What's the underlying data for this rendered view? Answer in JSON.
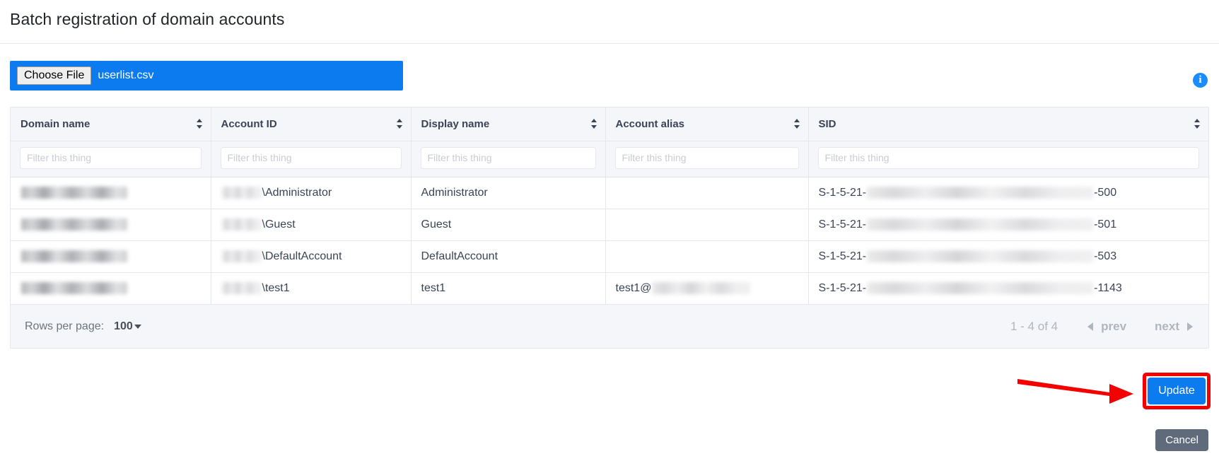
{
  "header": {
    "title": "Batch registration of domain accounts"
  },
  "file_upload": {
    "choose_label": "Choose File",
    "file_name": "userlist.csv",
    "info_icon_glyph": "i"
  },
  "table": {
    "columns": [
      {
        "label": "Domain name",
        "sortable": true
      },
      {
        "label": "Account ID",
        "sortable": true
      },
      {
        "label": "Display name",
        "sortable": true
      },
      {
        "label": "Account alias",
        "sortable": true
      },
      {
        "label": "SID",
        "sortable": true
      }
    ],
    "filter_placeholder": "Filter this thing",
    "filter_values": [
      "",
      "",
      "",
      "",
      ""
    ],
    "rows": [
      {
        "domain_name": "",
        "domain_redacted": true,
        "account_id_prefix": "",
        "account_id_redacted": true,
        "account_id": "\\Administrator",
        "display_name": "Administrator",
        "account_alias": "",
        "sid_prefix": "S-1-5-21-",
        "sid_redacted": true,
        "sid_suffix": "-500"
      },
      {
        "domain_name": "",
        "domain_redacted": true,
        "account_id_prefix": "",
        "account_id_redacted": true,
        "account_id": "\\Guest",
        "display_name": "Guest",
        "account_alias": "",
        "sid_prefix": "S-1-5-21-",
        "sid_redacted": true,
        "sid_suffix": "-501"
      },
      {
        "domain_name": "",
        "domain_redacted": true,
        "account_id_prefix": "",
        "account_id_redacted": true,
        "account_id": "\\DefaultAccount",
        "display_name": "DefaultAccount",
        "account_alias": "",
        "sid_prefix": "S-1-5-21-",
        "sid_redacted": true,
        "sid_suffix": "-503"
      },
      {
        "domain_name": "",
        "domain_redacted": true,
        "account_id_prefix": "",
        "account_id_redacted": true,
        "account_id": "\\test1",
        "display_name": "test1",
        "account_alias": "test1@",
        "account_alias_redacted": true,
        "sid_prefix": "S-1-5-21-",
        "sid_redacted": true,
        "sid_suffix": "-1143"
      }
    ]
  },
  "pagination": {
    "rows_per_page_label": "Rows per page:",
    "rows_per_page_value": "100",
    "range_text": "1 - 4 of 4",
    "prev_label": "prev",
    "next_label": "next"
  },
  "actions": {
    "update_label": "Update",
    "cancel_label": "Cancel"
  },
  "colors": {
    "accent_blue": "#0d7bf0",
    "annotation_red": "#f50000",
    "cancel_gray": "#5f6b7a",
    "header_bg": "#f4f6f9"
  }
}
